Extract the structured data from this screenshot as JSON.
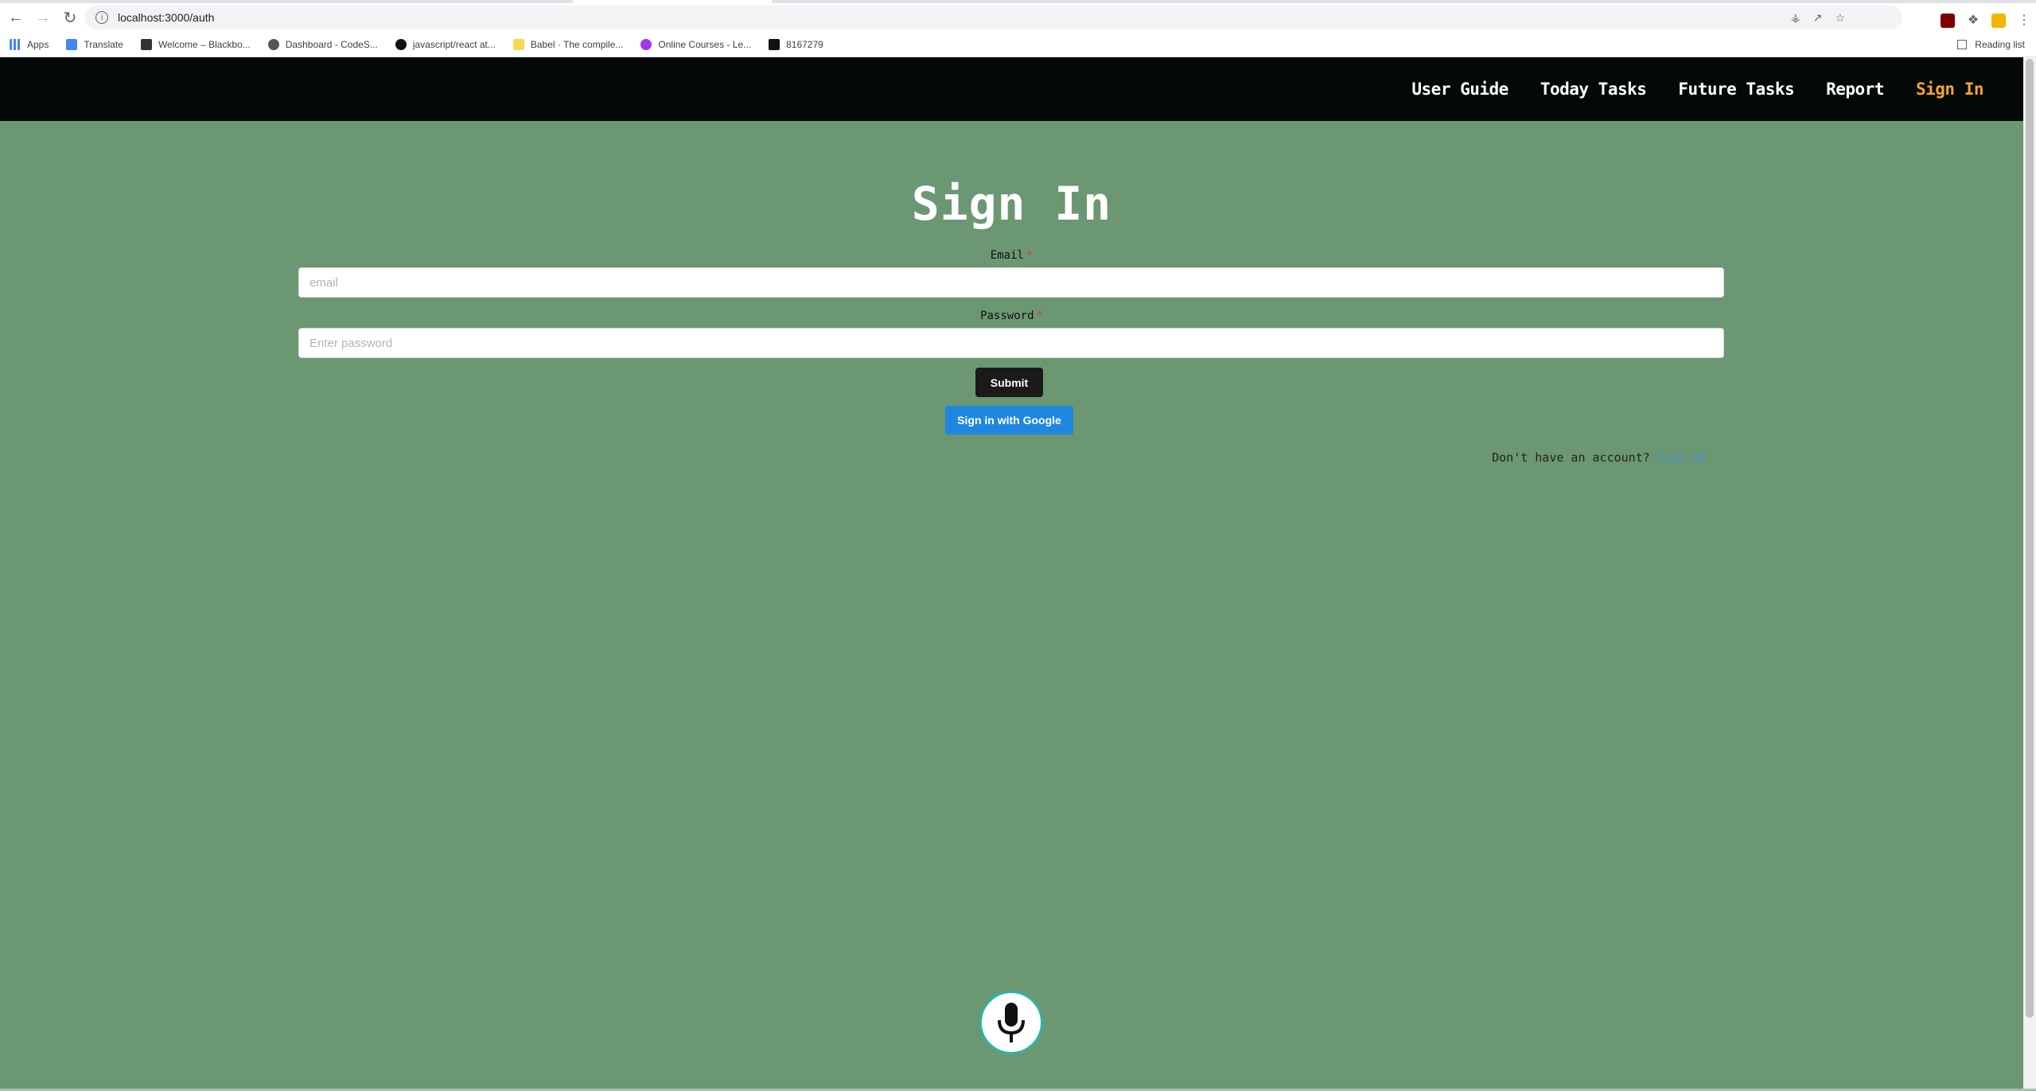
{
  "browser": {
    "url": "localhost:3000/auth",
    "bookmarks": [
      {
        "label": "Apps",
        "icon": "apps-grid-icon",
        "color": "#4285f4"
      },
      {
        "label": "Translate",
        "icon": "translate-icon",
        "color": "#4285f4"
      },
      {
        "label": "Welcome – Blackbo...",
        "icon": "blackboard-icon",
        "color": "#333333"
      },
      {
        "label": "Dashboard - CodeS...",
        "icon": "codesignal-icon",
        "color": "#555555"
      },
      {
        "label": "javascript/react at...",
        "icon": "github-icon",
        "color": "#111111"
      },
      {
        "label": "Babel · The compile...",
        "icon": "babel-icon",
        "color": "#f5da55"
      },
      {
        "label": "Online Courses - Le...",
        "icon": "courses-icon",
        "color": "#a435f0"
      },
      {
        "label": "8167279",
        "icon": "bb-icon",
        "color": "#111111"
      }
    ],
    "reading_list": "Reading list"
  },
  "navbar": {
    "links": [
      "User Guide",
      "Today Tasks",
      "Future Tasks",
      "Report"
    ],
    "active_link": "Sign In",
    "active_color": "#f5a623"
  },
  "form": {
    "title": "Sign In",
    "email_label": "Email",
    "email_placeholder": "email",
    "password_label": "Password",
    "password_placeholder": "Enter password",
    "required_mark": "*",
    "submit_label": "Submit",
    "google_label": "Sign in with Google",
    "no_account_text": "Don't have an account?",
    "signup_link": "Sign Up"
  },
  "colors": {
    "page_background": "#6b9773",
    "navbar_background": "#030808",
    "google_button": "#1f87e0",
    "mic_border": "#2bb5a8"
  }
}
